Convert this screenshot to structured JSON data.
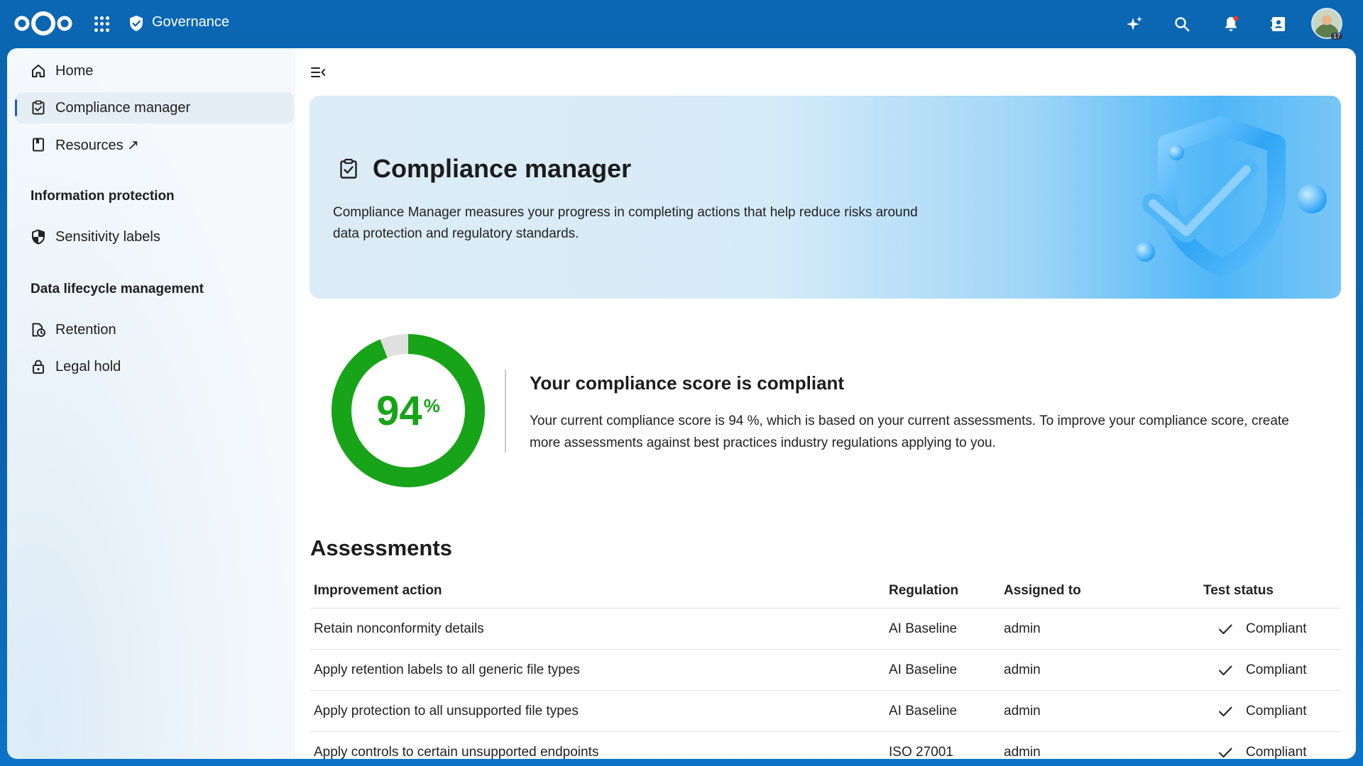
{
  "header": {
    "app_name": "Governance",
    "avatar_badge": "17",
    "icons": [
      "nextcloud-logo",
      "app-menu-icon",
      "governance-shield-icon",
      "assistant-sparkle-icon",
      "search-icon",
      "notifications-bell-icon",
      "contacts-icon",
      "user-avatar"
    ]
  },
  "sidebar": {
    "items": [
      {
        "label": "Home",
        "icon": "home-icon"
      },
      {
        "label": "Compliance manager",
        "icon": "clipboard-check-icon",
        "active": true
      },
      {
        "label": "Resources ↗",
        "icon": "bookmark-icon"
      }
    ],
    "sections": [
      {
        "title": "Information protection",
        "items": [
          {
            "label": "Sensitivity labels",
            "icon": "shield-half-icon"
          }
        ]
      },
      {
        "title": "Data lifecycle management",
        "items": [
          {
            "label": "Retention",
            "icon": "file-clock-icon"
          },
          {
            "label": "Legal hold",
            "icon": "lock-icon"
          }
        ]
      }
    ]
  },
  "hero": {
    "title": "Compliance manager",
    "description": "Compliance Manager measures your progress in completing actions that help reduce risks around data protection and regulatory standards."
  },
  "score": {
    "value": 94,
    "value_text": "94",
    "unit": "%",
    "title": "Your compliance score is compliant",
    "description": "Your current compliance score is 94 %, which is based on your current assessments. To improve your compliance score, create more assessments against best practices industry regulations applying to you.",
    "ring_color": "#18a418",
    "ring_track_color": "#e0e0e0"
  },
  "assessments": {
    "title": "Assessments",
    "columns": [
      "Improvement action",
      "Regulation",
      "Assigned to",
      "Test status"
    ],
    "rows": [
      {
        "action": "Retain nonconformity details",
        "regulation": "AI Baseline",
        "assigned": "admin",
        "status": "Compliant"
      },
      {
        "action": "Apply retention labels to all generic file types",
        "regulation": "AI Baseline",
        "assigned": "admin",
        "status": "Compliant"
      },
      {
        "action": "Apply protection to all unsupported file types",
        "regulation": "AI Baseline",
        "assigned": "admin",
        "status": "Compliant"
      },
      {
        "action": "Apply controls to certain unsupported endpoints",
        "regulation": "ISO 27001",
        "assigned": "admin",
        "status": "Compliant"
      }
    ]
  },
  "colors": {
    "topbar": "#0a62ad",
    "accent": "#1662b7",
    "success": "#18a418"
  }
}
